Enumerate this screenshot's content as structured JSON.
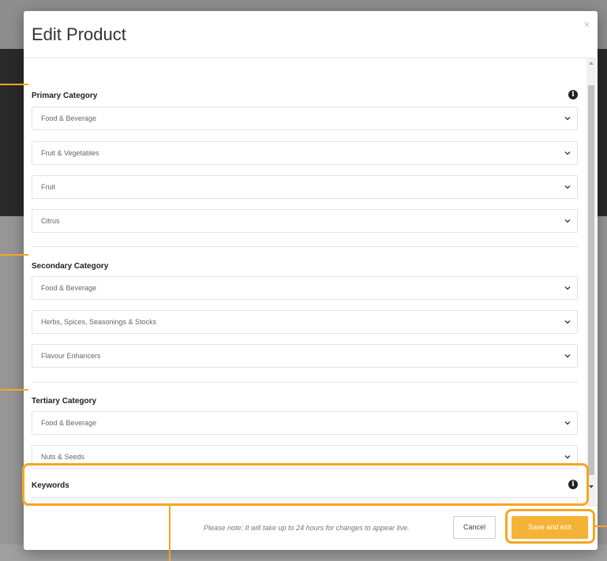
{
  "modal": {
    "title": "Edit Product",
    "close_label": "×"
  },
  "primary": {
    "label": "Primary Category",
    "selects": [
      "Food & Beverage",
      "Fruit & Vegetables",
      "Fruit",
      "Citrus"
    ]
  },
  "secondary": {
    "label": "Secondary Category",
    "selects": [
      "Food & Beverage",
      "Herbs, Spices, Seasonings & Stocks",
      "Flavour Enhancers"
    ]
  },
  "tertiary": {
    "label": "Tertiary Category",
    "selects": [
      "Food & Beverage",
      "Nuts & Seeds"
    ]
  },
  "keywords": {
    "label": "Keywords",
    "value": ""
  },
  "footer": {
    "note": "Please note: It will take up to 24 hours for changes to appear live.",
    "cancel_label": "Cancel",
    "save_label": "Save and exit"
  },
  "info_icon_glyph": "i",
  "colors": {
    "accent": "#f5b335",
    "highlight": "#f5a623",
    "backdrop_dark": "#2a2a2a"
  }
}
